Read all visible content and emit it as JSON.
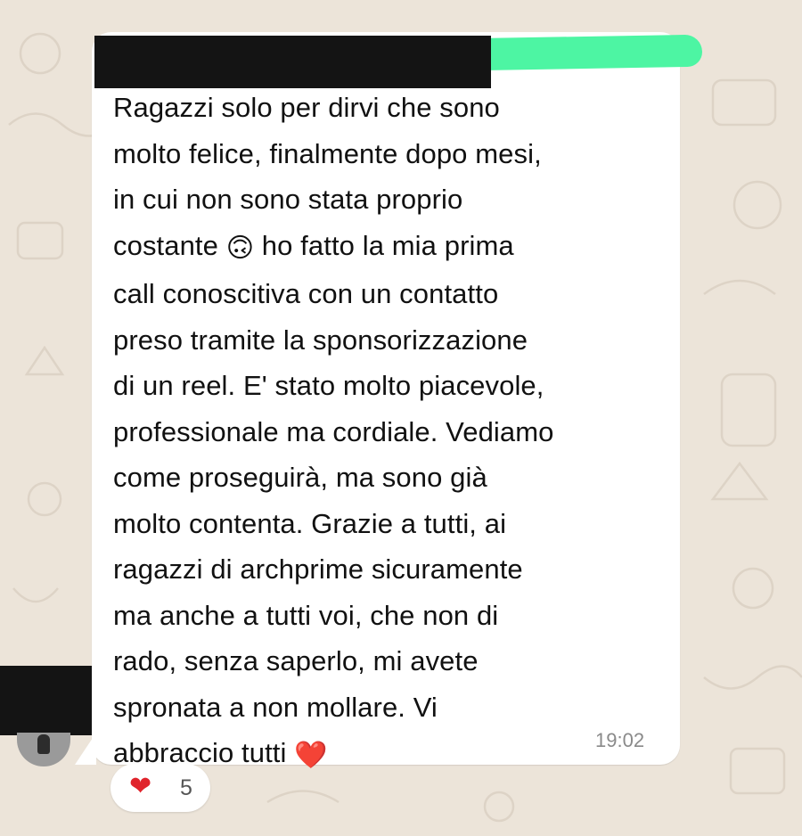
{
  "message": {
    "line1": "Ragazzi solo per dirvi che sono\nmolto felice, finalmente dopo mesi,\nin cui non sono stata proprio\ncostante ",
    "emoji1": "🙃",
    "line2": " ho fatto la mia prima\ncall conoscitiva con un contatto\npreso tramite la sponsorizzazione\ndi un reel. E' stato molto piacevole,\nprofessionale ma cordiale. Vediamo\ncome proseguirà, ma sono già\nmolto contenta. Grazie a tutti, ai\nragazzi di archprime sicuramente\nma anche a tutti voi, che non di\nrado, senza saperlo, mi avete\nspronata a non mollare. Vi\nabbraccio tutti ",
    "emoji2": "❤️",
    "time": "19:02"
  },
  "reaction": {
    "emoji": "❤",
    "count": "5"
  },
  "colors": {
    "background": "#ece4d9",
    "bubble": "#ffffff",
    "highlight": "#4df5a3",
    "redaction": "#141414"
  }
}
